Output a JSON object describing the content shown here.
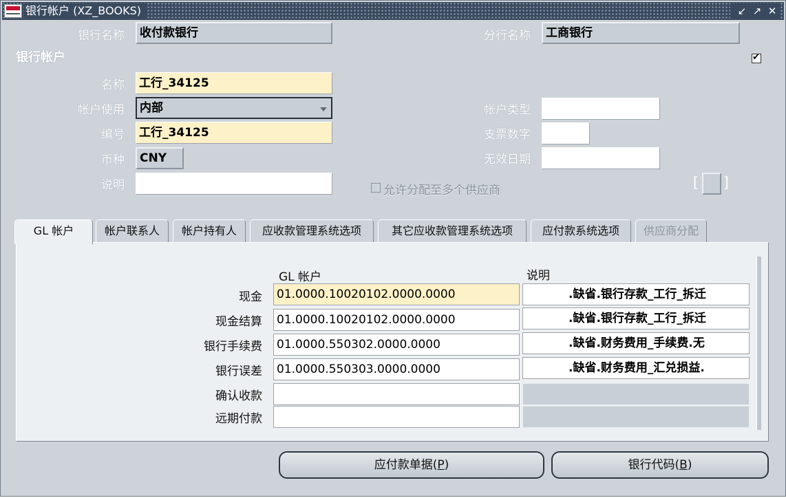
{
  "window": {
    "title": "银行帐户 (XZ_BOOKS)",
    "controls": [
      "↙",
      "↗",
      "✕"
    ]
  },
  "bank": {
    "name_label": "银行名称",
    "name_value": "收付款银行",
    "branch_label": "分行名称",
    "branch_value": "工商银行"
  },
  "account": {
    "section_title": "银行帐户",
    "section_checked": true,
    "name_label": "名称",
    "name_value": "工行_34125",
    "usage_label": "帐户使用",
    "usage_value": "内部",
    "number_label": "编号",
    "number_value": "工行_34125",
    "currency_label": "币种",
    "currency_value": "CNY",
    "desc_label": "说明",
    "desc_value": "",
    "type_label": "帐户类型",
    "type_value": "",
    "check_digits_label": "支票数字",
    "check_digits_value": "",
    "inactive_date_label": "无效日期",
    "inactive_date_value": "",
    "multi_supplier_label": "允许分配至多个供应商",
    "multi_supplier_checked": false,
    "bracket_left": "[",
    "bracket_right": "]"
  },
  "tabs": [
    {
      "label": "GL 帐户",
      "active": true
    },
    {
      "label": "帐户联系人"
    },
    {
      "label": "帐户持有人"
    },
    {
      "label": "应收款管理系统选项"
    },
    {
      "label": "其它应收款管理系统选项"
    },
    {
      "label": "应付款系统选项"
    },
    {
      "label": "供应商分配",
      "disabled": true
    }
  ],
  "gl": {
    "col_account": "GL 帐户",
    "col_desc": "说明",
    "rows": [
      {
        "label": "现金",
        "account": "01.0000.10020102.0000.0000",
        "desc": ".缺省.银行存款_工行_拆迁"
      },
      {
        "label": "现金结算",
        "account": "01.0000.10020102.0000.0000",
        "desc": ".缺省.银行存款_工行_拆迁"
      },
      {
        "label": "银行手续费",
        "account": "01.0000.550302.0000.0000",
        "desc": ".缺省.财务费用_手续费.无"
      },
      {
        "label": "银行误差",
        "account": "01.0000.550303.0000.0000",
        "desc": ".缺省.财务费用_汇兑损益."
      },
      {
        "label": "确认收款",
        "account": "",
        "desc": ""
      },
      {
        "label": "远期付款",
        "account": "",
        "desc": ""
      }
    ]
  },
  "buttons": {
    "payables_label": "应付款单据(",
    "payables_mnemonic": "P",
    "payables_close": ")",
    "bank_codes_label": "银行代码(",
    "bank_codes_mnemonic": "B",
    "bank_codes_close": ")"
  }
}
